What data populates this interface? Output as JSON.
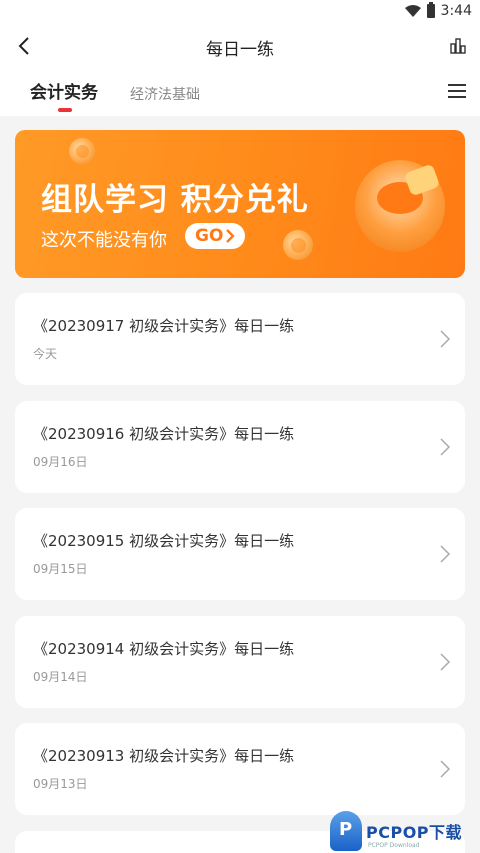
{
  "status": {
    "time": "3:44"
  },
  "nav": {
    "title": "每日一练"
  },
  "tabs": {
    "active": "会计实务",
    "inactive": "经济法基础"
  },
  "banner": {
    "title": "组队学习 积分兑礼",
    "subtitle": "这次不能没有你",
    "go": "GO"
  },
  "items": [
    {
      "title": "《20230917 初级会计实务》每日一练",
      "date": "今天"
    },
    {
      "title": "《20230916 初级会计实务》每日一练",
      "date": "09月16日"
    },
    {
      "title": "《20230915 初级会计实务》每日一练",
      "date": "09月15日"
    },
    {
      "title": "《20230914 初级会计实务》每日一练",
      "date": "09月14日"
    },
    {
      "title": "《20230913 初级会计实务》每日一练",
      "date": "09月13日"
    }
  ],
  "watermark": {
    "brand": "PCPOP下载",
    "small": "PCPOP Download"
  },
  "colors": {
    "accent": "#e9343a",
    "banner": "#ff8a1a"
  }
}
